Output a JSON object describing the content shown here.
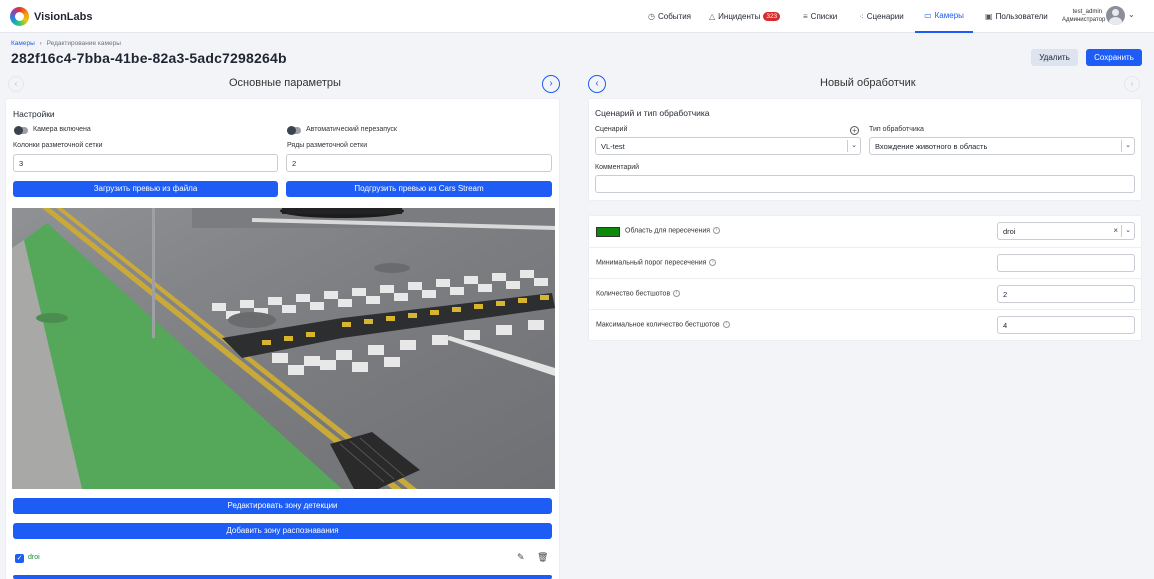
{
  "brand": {
    "name": "VisionLabs"
  },
  "nav": [
    {
      "label": "События",
      "icon": "clock-icon"
    },
    {
      "label": "Инциденты",
      "icon": "warning-icon",
      "badge": "323"
    },
    {
      "label": "Списки",
      "icon": "list-icon"
    },
    {
      "label": "Сценарии",
      "icon": "scenario-icon"
    },
    {
      "label": "Камеры",
      "icon": "camera-icon",
      "active": true
    },
    {
      "label": "Пользователи",
      "icon": "users-icon"
    }
  ],
  "user": {
    "name": "test_admin",
    "role": "Администратор"
  },
  "breadcrumb": {
    "root": "Камеры",
    "separator": "›",
    "current": "Редактирование камеры"
  },
  "page": {
    "title": "282f16c4-7bba-41be-82a3-5adc7298264b"
  },
  "actions": {
    "delete": "Удалить",
    "save": "Сохранить"
  },
  "left": {
    "section_title": "Основные параметры",
    "card_title": "Настройки",
    "camera_enabled": "Камера включена",
    "auto_restart": "Автоматический перезапуск",
    "grid_cols_label": "Колонки разметочной сетки",
    "grid_cols_value": "3",
    "grid_rows_label": "Ряды разметочной сетки",
    "grid_rows_value": "2",
    "upload_preview": "Загрузить превью из файла",
    "load_preview_cars": "Подгрузить превью из Cars Stream",
    "edit_detection_zone": "Редактировать зону детекции",
    "add_recognition_zone": "Добавить зону распознавания",
    "zone_name": "droi"
  },
  "right": {
    "section_title": "Новый обработчик",
    "card_title": "Сценарий и тип обработчика",
    "scenario_label": "Сценарий",
    "scenario_value": "VL-test",
    "handler_type_label": "Тип обработчика",
    "handler_type_value": "Вхождение животного в область",
    "comment_label": "Комментарий",
    "comment_value": "",
    "intersection_area_label": "Область для пересечения",
    "intersection_area_value": "droi",
    "min_threshold_label": "Минимальный порог пересечения",
    "min_threshold_value": "",
    "bestshots_label": "Количество бестшотов",
    "bestshots_value": "2",
    "max_bestshots_label": "Максимальное количество бестшотов",
    "max_bestshots_value": "4"
  },
  "colors": {
    "accent": "#1d5cf5",
    "badge": "#d92b2b",
    "zone_green": "#0c8a0c"
  }
}
